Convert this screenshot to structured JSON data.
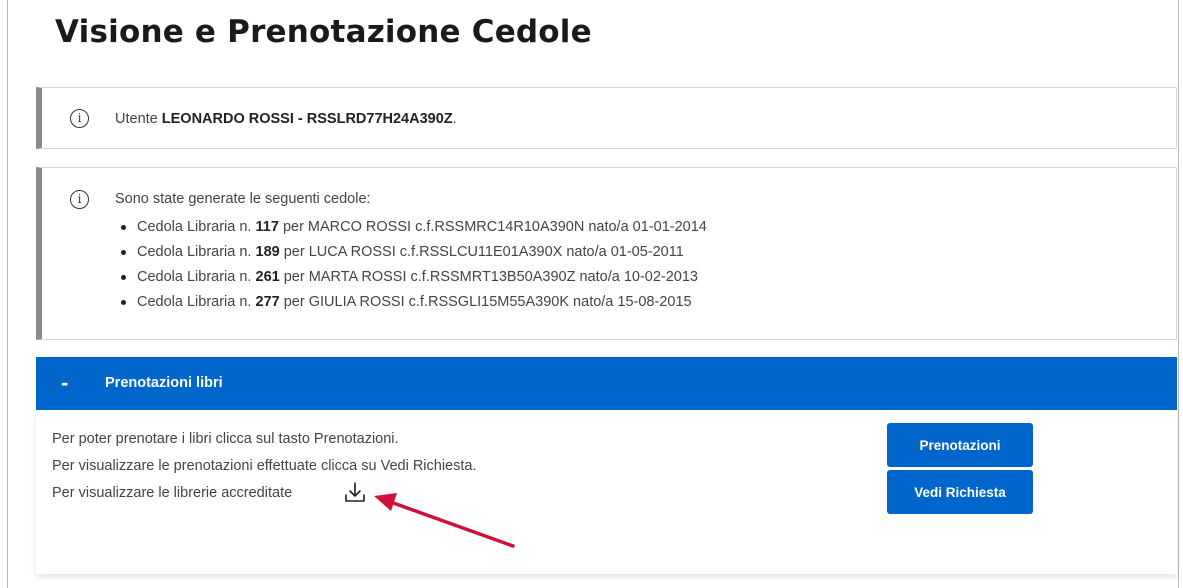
{
  "page": {
    "title": "Visione e Prenotazione Cedole"
  },
  "user_box": {
    "prefix": "Utente",
    "name_cf": "LEONARDO ROSSI - RSSLRD77H24A390Z",
    "suffix": "."
  },
  "cedole_box": {
    "intro": "Sono state generate le seguenti cedole:",
    "items": [
      {
        "prefix": "Cedola Libraria n.",
        "number": "117",
        "rest": "per MARCO ROSSI c.f.RSSMRC14R10A390N nato/a 01-01-2014"
      },
      {
        "prefix": "Cedola Libraria n.",
        "number": "189",
        "rest": "per LUCA ROSSI c.f.RSSLCU11E01A390X nato/a 01-05-2011"
      },
      {
        "prefix": "Cedola Libraria n.",
        "number": "261",
        "rest": "per MARTA ROSSI c.f.RSSMRT13B50A390Z nato/a 10-02-2013"
      },
      {
        "prefix": "Cedola Libraria n.",
        "number": "277",
        "rest": "per GIULIA ROSSI c.f.RSSGLI15M55A390K nato/a 15-08-2015"
      }
    ]
  },
  "panel": {
    "toggle": "-",
    "title": "Prenotazioni libri",
    "lines": [
      "Per poter prenotare i libri clicca sul tasto Prenotazioni.",
      "Per visualizzare le prenotazioni effettuate clicca su Vedi Richiesta.",
      "Per visualizzare le librerie accreditate"
    ],
    "buttons": {
      "prenotazioni": "Prenotazioni",
      "vedi_richiesta": "Vedi Richiesta"
    }
  },
  "icons": {
    "info": "info-circle-icon",
    "download": "download-icon",
    "annotation": "red-arrow-annotation"
  },
  "colors": {
    "primary": "#0066cc",
    "annotation_arrow": "#d0103a",
    "info_border": "#8a8a8a"
  }
}
